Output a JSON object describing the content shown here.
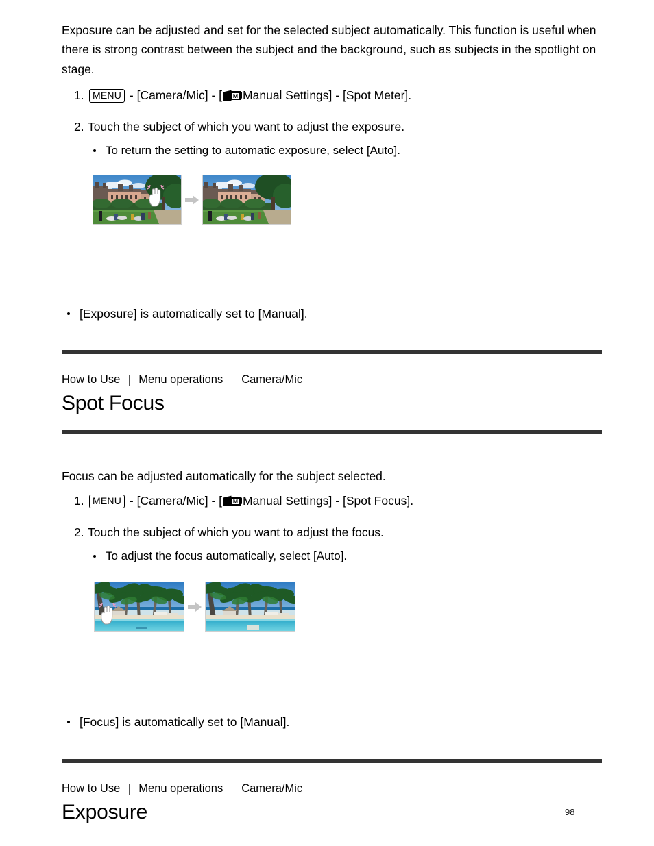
{
  "document": {
    "page_number": "98",
    "rule_color": "#333333"
  },
  "section_spot_meter": {
    "intro": "Exposure can be adjusted and set for the selected subject automatically. This function is useful when there is strong contrast between the subject and the background, such as subjects in the spotlight on stage.",
    "steps": [
      {
        "number": "1.",
        "menu_key": "MENU",
        "icon": "manual-settings-camcorder-icon",
        "text_before_icon": " - [Camera/Mic] - [",
        "text_after_icon": "Manual Settings] - [Spot Meter]."
      },
      {
        "number": "2.",
        "text": "Touch the subject of which you want to adjust the exposure.",
        "sub_bullets": [
          "To return the setting to automatic exposure, select [Auto]."
        ]
      }
    ],
    "figure": {
      "left_caption": "park-scene-before-touch",
      "arrow": "arrow-right-icon",
      "right_caption": "park-scene-after-touch"
    },
    "note": "[Exposure] is automatically set to [Manual]."
  },
  "section_spot_focus": {
    "breadcrumb": [
      "How to Use",
      "Menu operations",
      "Camera/Mic"
    ],
    "heading": "Spot Focus",
    "intro": "Focus can be adjusted automatically for the subject selected.",
    "steps": [
      {
        "number": "1.",
        "menu_key": "MENU",
        "icon": "manual-settings-camcorder-icon",
        "text_before_icon": " - [Camera/Mic] - [",
        "text_after_icon": "Manual Settings] - [Spot Focus]."
      },
      {
        "number": "2.",
        "text": "Touch the subject of which you want to adjust the focus.",
        "sub_bullets": [
          "To adjust the focus automatically, select [Auto]."
        ]
      }
    ],
    "figure": {
      "left_caption": "beach-scene-before-touch",
      "arrow": "arrow-right-icon",
      "right_caption": "beach-scene-after-touch"
    },
    "note": "[Focus] is automatically set to [Manual]."
  },
  "section_exposure": {
    "breadcrumb": [
      "How to Use",
      "Menu operations",
      "Camera/Mic"
    ],
    "heading": "Exposure"
  }
}
